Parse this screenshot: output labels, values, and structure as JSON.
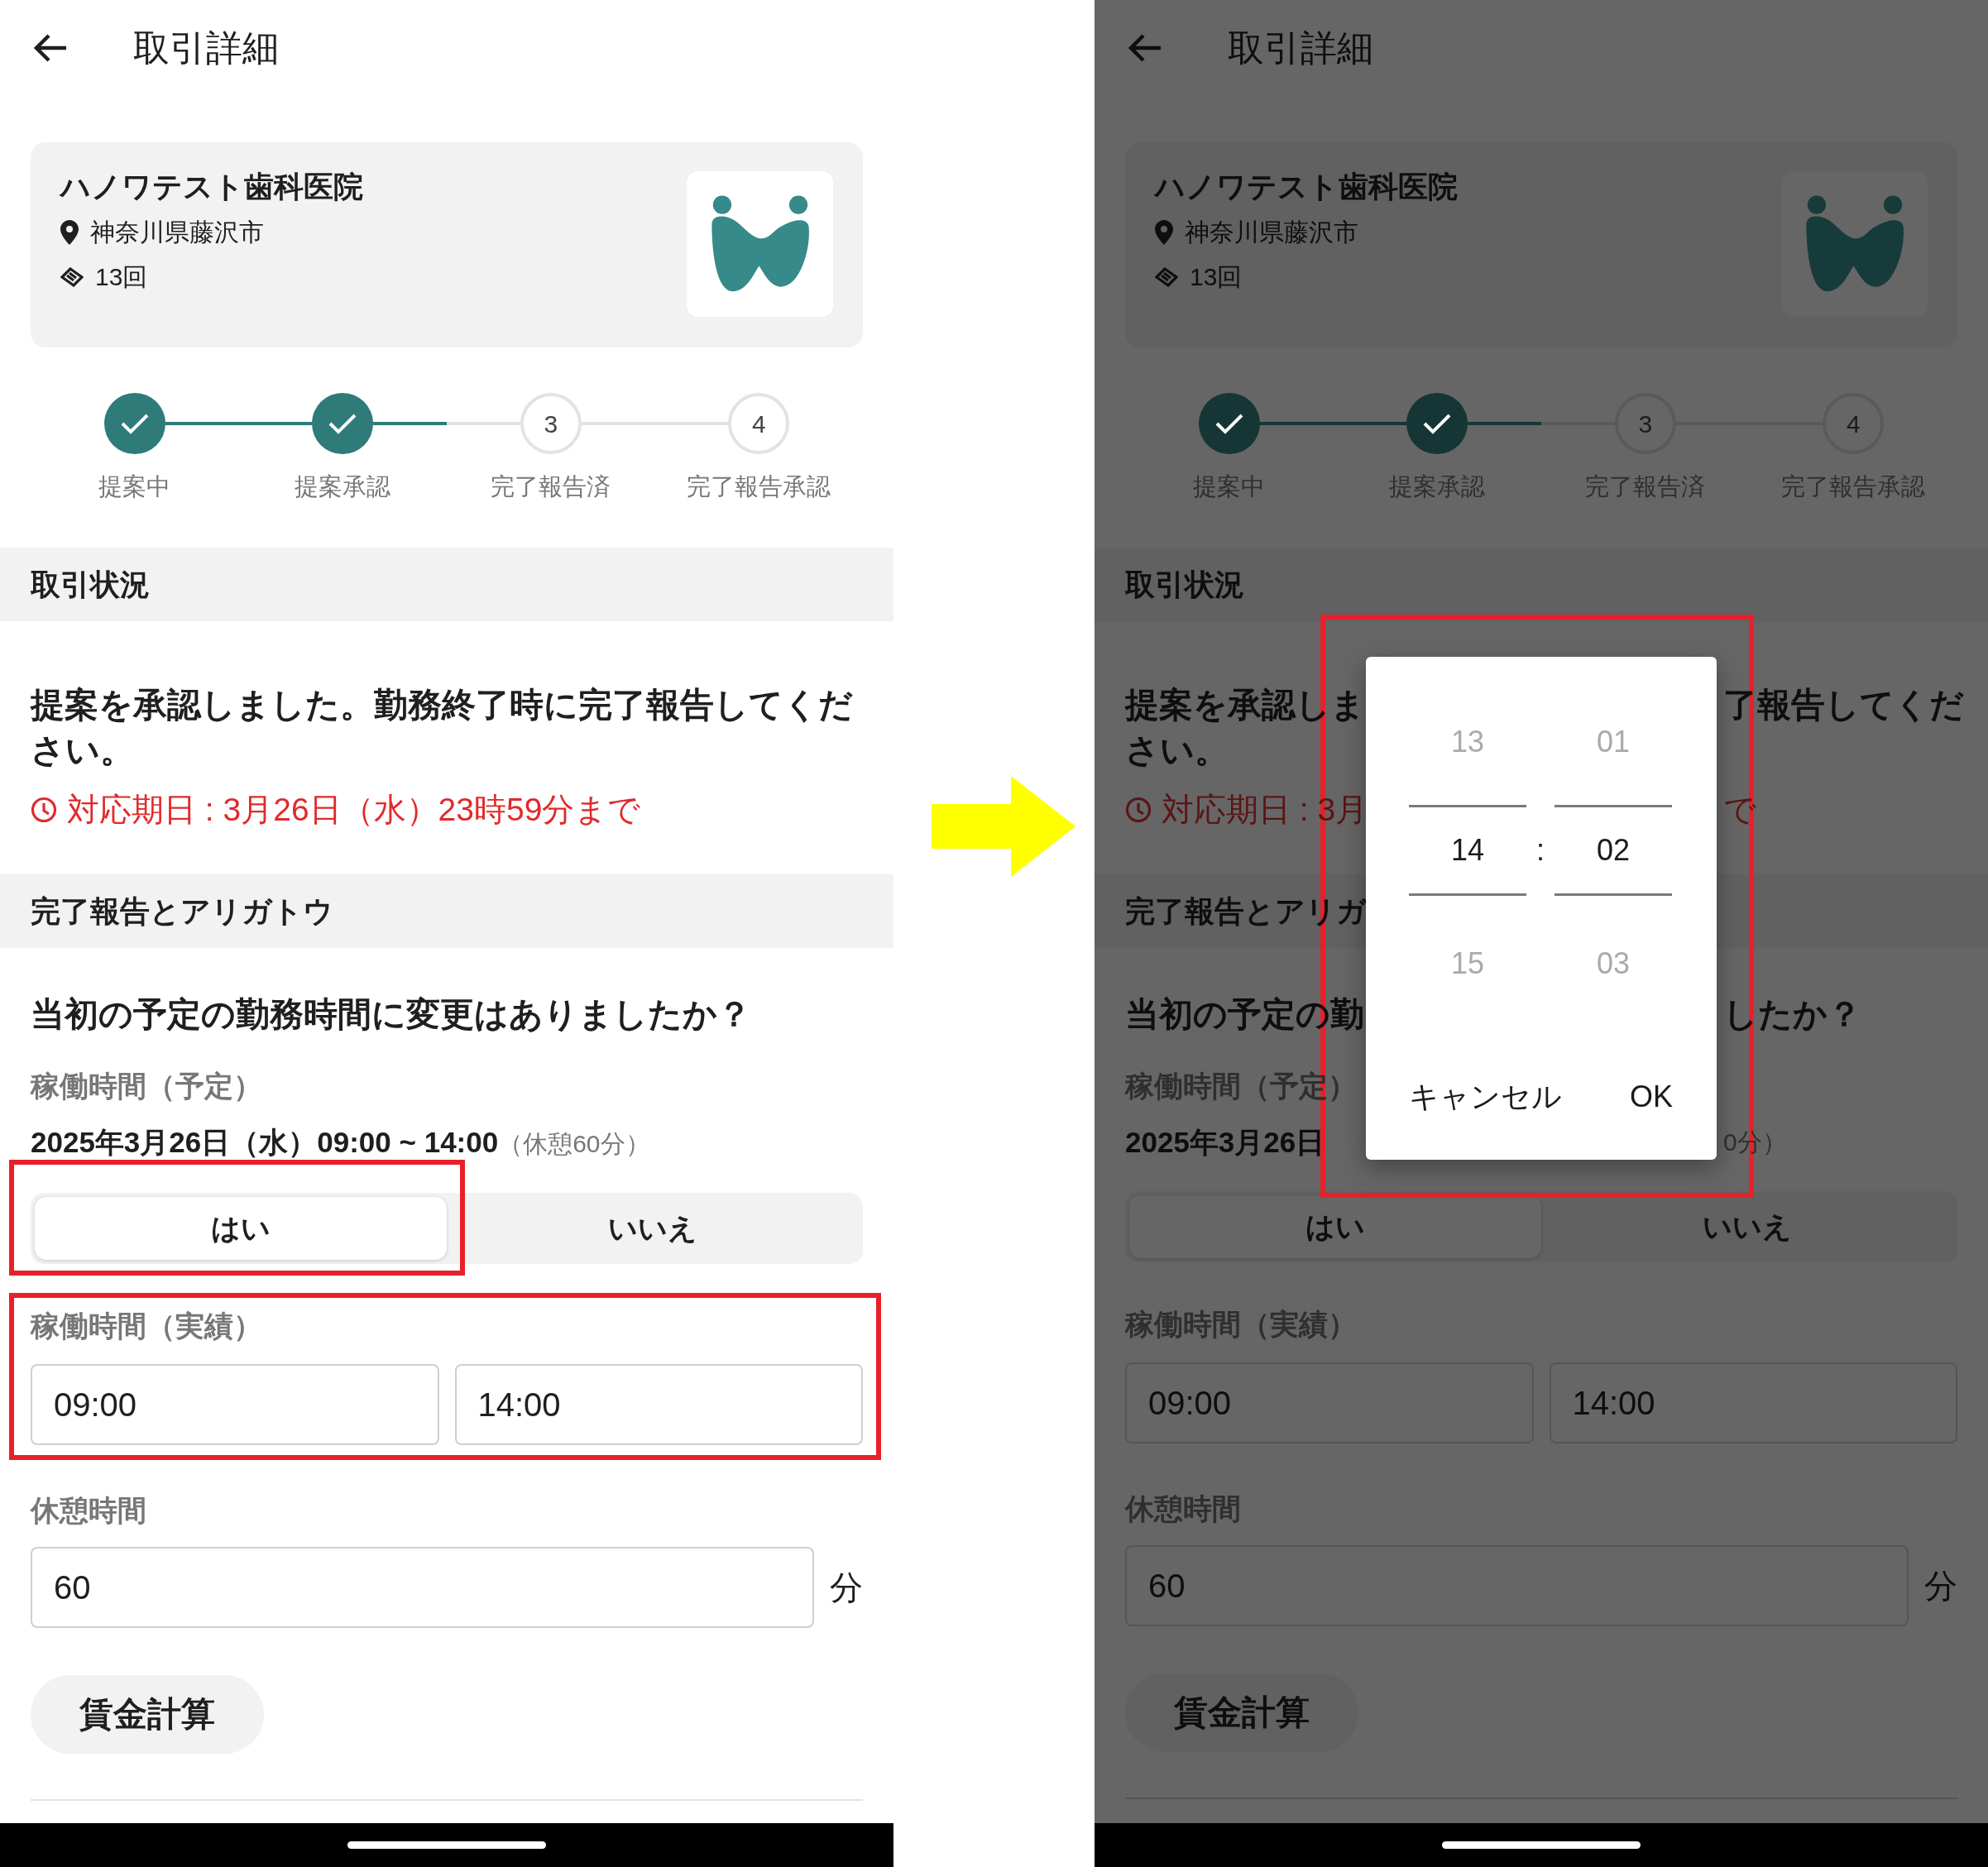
{
  "before": {
    "title": "取引詳細",
    "clinic": {
      "name": "ハノワテスト歯科医院",
      "address": "神奈川県藤沢市",
      "count": "13回"
    },
    "steps": [
      {
        "label": "提案中",
        "done": true
      },
      {
        "label": "提案承認",
        "done": true
      },
      {
        "label": "完了報告済",
        "number": "3",
        "done": false
      },
      {
        "label": "完了報告承認",
        "number": "4",
        "done": false
      }
    ],
    "status_header": "取引状況",
    "message": "提案を承認しました。勤務終了時に完了報告してください。",
    "deadline": "対応期日 : 3月26日（水）23時59分まで",
    "report_header": "完了報告とアリガトウ",
    "question": "当初の予定の勤務時間に変更はありましたか？",
    "planned_label": "稼働時間（予定）",
    "planned_time": "2025年3月26日（水）09:00 ~ 14:00",
    "planned_break": "（休憩60分）",
    "answer_options": [
      {
        "label": "はい",
        "selected": true
      },
      {
        "label": "いいえ",
        "selected": false
      }
    ],
    "actual_label": "稼働時間（実績）",
    "actual_start": "09:00",
    "actual_end": "14:00",
    "break_label": "休憩時間",
    "break_value": "60",
    "break_unit": "分",
    "calc_button": "賃金計算"
  },
  "after": {
    "title": "取引詳細",
    "clinic": {
      "name": "ハノワテスト歯科医院",
      "address": "神奈川県藤沢市",
      "count": "13回"
    },
    "steps": [
      {
        "label": "提案中",
        "done": true
      },
      {
        "label": "提案承認",
        "done": true
      },
      {
        "label": "完了報告済",
        "number": "3",
        "done": false
      },
      {
        "label": "完了報告承認",
        "number": "4",
        "done": false
      }
    ],
    "status_header": "取引状況",
    "message": [
      "提案を承認しま",
      "了報告してくだ",
      "さい。"
    ],
    "deadline": [
      "対応期日 : 3月",
      "で"
    ],
    "report_header": "完了報告とアリガ",
    "question": [
      "当初の予定の勤",
      "したか？"
    ],
    "planned_label": "稼働時間（予定）",
    "planned_time": [
      "2025年3月26日",
      "0分）"
    ],
    "answer_options": [
      {
        "label": "はい",
        "selected": true
      },
      {
        "label": "いいえ",
        "selected": false
      }
    ],
    "actual_label": "稼働時間（実績）",
    "actual_start": "09:00",
    "actual_end": "14:00",
    "break_label": "休憩時間",
    "break_value": "60",
    "break_unit": "分",
    "calc_button": "賃金計算",
    "time_picker": {
      "hours": [
        {
          "value": "13",
          "selected": false
        },
        {
          "value": "14",
          "selected": true
        },
        {
          "value": "15",
          "selected": false
        }
      ],
      "separator": ":",
      "minutes": [
        {
          "value": "01",
          "selected": false
        },
        {
          "value": "02",
          "selected": true
        },
        {
          "value": "03",
          "selected": false
        }
      ],
      "cancel": "キャンセル",
      "ok": "OK"
    }
  }
}
